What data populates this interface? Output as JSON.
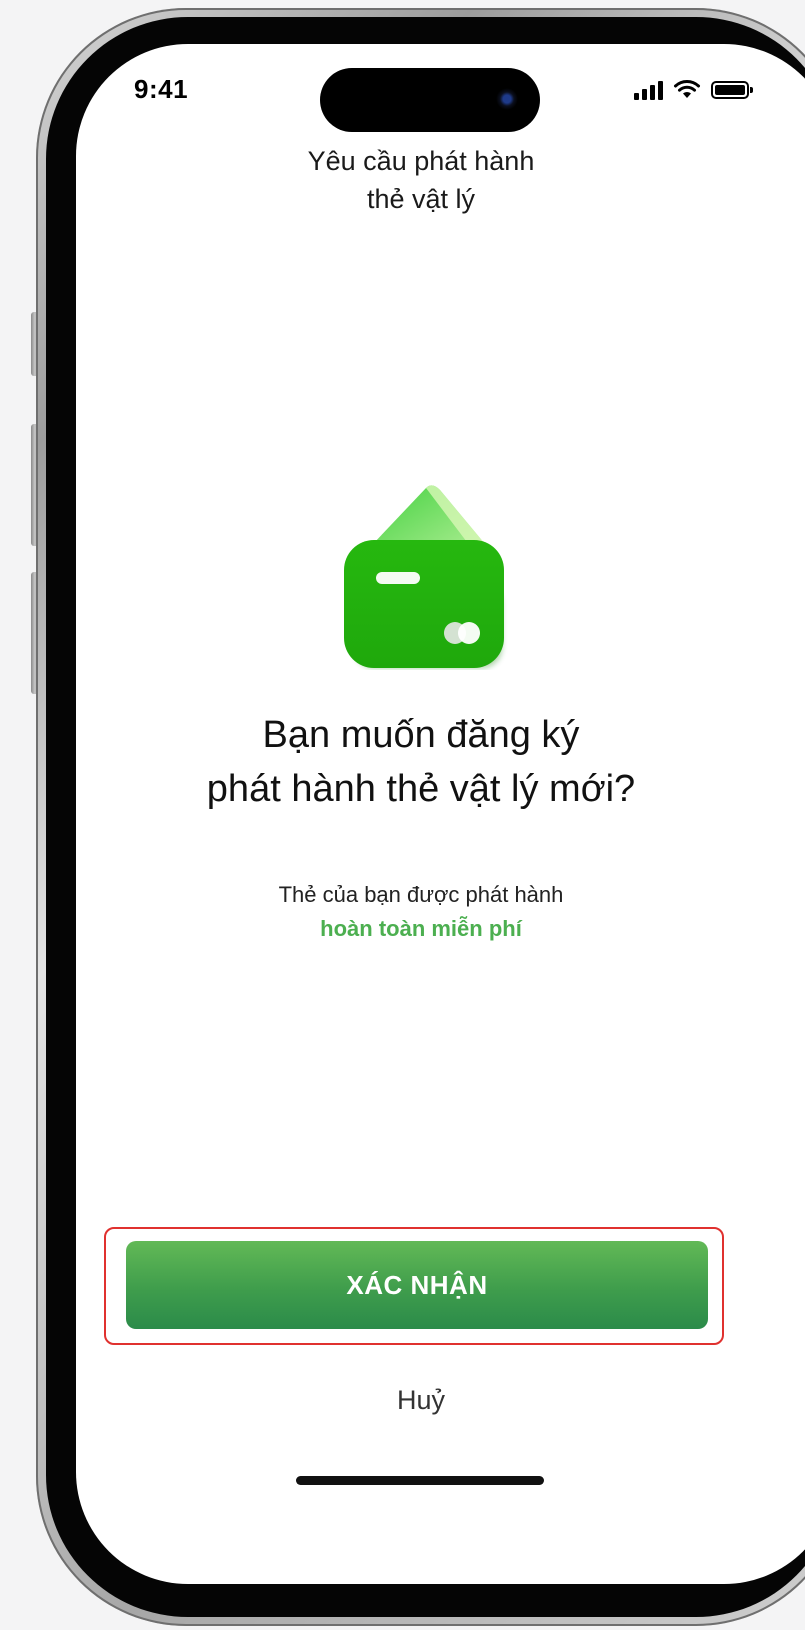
{
  "status_bar": {
    "time": "9:41",
    "icons": [
      "cellular-signal-icon",
      "wifi-icon",
      "battery-icon"
    ]
  },
  "header": {
    "title": "Yêu cầu phát hành\nthẻ vật lý"
  },
  "illustration": {
    "icon": "card-wallet-icon",
    "colors": {
      "card_front": "#22b30b",
      "card_back": "#8ee07a"
    }
  },
  "content": {
    "title": "Bạn muốn đăng ký\nphát hành thẻ vật lý mới?",
    "subtitle": "Thẻ của bạn được phát hành",
    "highlight": "hoàn toàn miễn phí"
  },
  "actions": {
    "confirm_label": "XÁC NHẬN",
    "cancel_label": "Huỷ"
  },
  "colors": {
    "accent": "#4caf50",
    "button_top": "#62b956",
    "button_bottom": "#2b8b4a",
    "highlight_outline": "#e0312f"
  }
}
